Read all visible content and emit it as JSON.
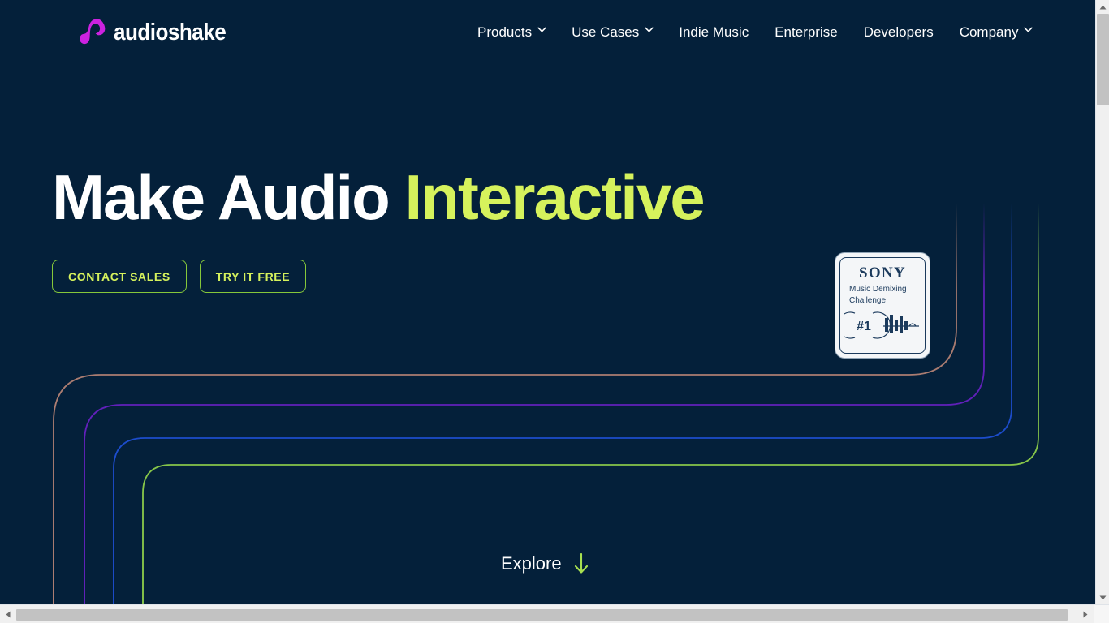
{
  "brand": {
    "name": "audioshake",
    "logo_icon": "audioshake-note-logo-icon",
    "logo_color": "#cc22e0",
    "accent_green": "#d6f25c",
    "background": "#04203a"
  },
  "nav": {
    "items": [
      {
        "label": "Products",
        "has_caret": true,
        "caret_icon": "chevron-down-icon"
      },
      {
        "label": "Use Cases",
        "has_caret": true,
        "caret_icon": "chevron-down-icon"
      },
      {
        "label": "Indie Music",
        "has_caret": false
      },
      {
        "label": "Enterprise",
        "has_caret": false
      },
      {
        "label": "Developers",
        "has_caret": false
      },
      {
        "label": "Company",
        "has_caret": true,
        "caret_icon": "chevron-down-icon"
      }
    ]
  },
  "hero": {
    "title_plain": "Make Audio ",
    "title_accent": "Interactive",
    "buttons": [
      {
        "label": "CONTACT SALES",
        "name": "contact-sales-button"
      },
      {
        "label": "TRY IT FREE",
        "name": "try-it-free-button"
      }
    ]
  },
  "award_badge": {
    "brand": "SONY",
    "line1": "Music Demixing",
    "line2": "Challenge",
    "rank": "#1",
    "graphic_icon": "waveform-bars-icon",
    "border_color": "#1b3a5c",
    "background": "#f4f6f8"
  },
  "explore": {
    "label": "Explore",
    "arrow_icon": "arrow-down-icon",
    "arrow_color": "#a8e050"
  },
  "decoration": {
    "lines": [
      {
        "name": "salmon-line",
        "color": "#c08878"
      },
      {
        "name": "violet-line",
        "color": "#6b20c8"
      },
      {
        "name": "blue-line",
        "color": "#1e50d8"
      },
      {
        "name": "green-line",
        "color": "#8fd04a"
      }
    ]
  },
  "scrollbars": {
    "vertical": {
      "up_icon": "scroll-up-arrow-icon",
      "down_icon": "scroll-down-arrow-icon"
    },
    "horizontal": {
      "left_icon": "scroll-left-arrow-icon",
      "right_icon": "scroll-right-arrow-icon"
    }
  }
}
